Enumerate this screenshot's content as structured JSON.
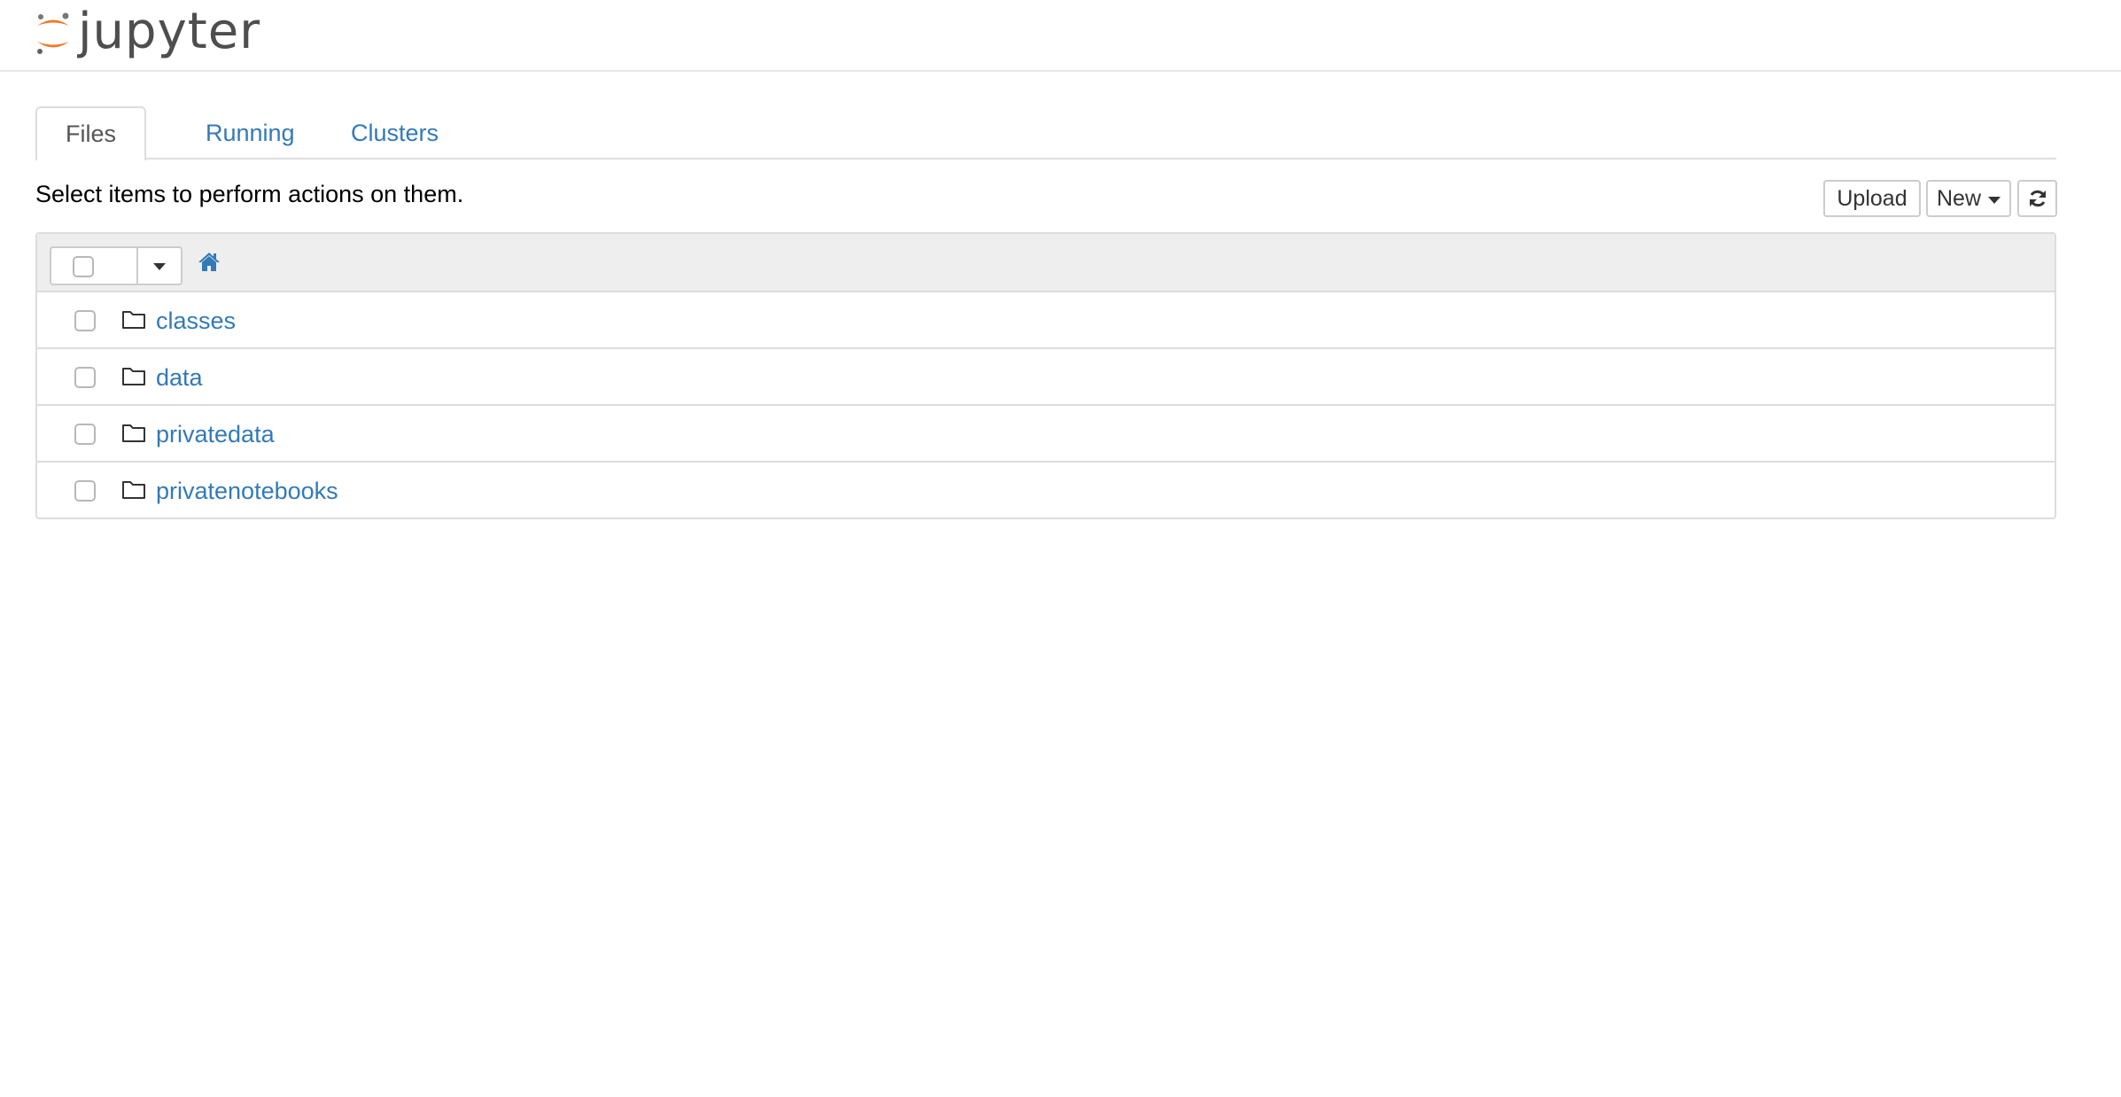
{
  "header": {
    "logo_text": "jupyter"
  },
  "tabs": [
    {
      "label": "Files",
      "active": true
    },
    {
      "label": "Running",
      "active": false
    },
    {
      "label": "Clusters",
      "active": false
    }
  ],
  "toolbar": {
    "instructions": "Select items to perform actions on them.",
    "upload_label": "Upload",
    "new_label": "New"
  },
  "file_list": {
    "items": [
      {
        "name": "classes",
        "type": "folder"
      },
      {
        "name": "data",
        "type": "folder"
      },
      {
        "name": "privatedata",
        "type": "folder"
      },
      {
        "name": "privatenotebooks",
        "type": "folder"
      }
    ]
  },
  "colors": {
    "link": "#337ab7",
    "brand_orange": "#f37726",
    "logo_text": "#4e4e4e"
  },
  "icons": {
    "home": "home-icon",
    "folder": "folder-icon",
    "refresh": "refresh-icon",
    "dropdown": "caret-down-icon"
  }
}
